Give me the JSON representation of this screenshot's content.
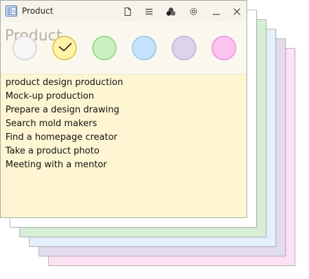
{
  "window": {
    "title": "Product",
    "ghost_title": "Product"
  },
  "toolbar": {
    "icons": [
      "app-note-icon",
      "new-note-icon",
      "list-icon",
      "color-icon",
      "settings-icon",
      "minimize-icon",
      "close-icon"
    ]
  },
  "colors": {
    "swatches": [
      {
        "name": "white",
        "fill": "#f6f6f6",
        "selected": false
      },
      {
        "name": "yellow",
        "fill": "#fff3a8",
        "selected": true
      },
      {
        "name": "green",
        "fill": "#c8f0c0",
        "selected": false
      },
      {
        "name": "blue",
        "fill": "#c4e4fb",
        "selected": false
      },
      {
        "name": "purple",
        "fill": "#ddd3ea",
        "selected": false
      },
      {
        "name": "pink",
        "fill": "#fcc4f0",
        "selected": false
      }
    ],
    "note_background": "#fef6d2",
    "stacked_sheets": [
      "#ffffff",
      "#d6efd6",
      "#e4f0fb",
      "#e3dcee",
      "#fde2f3"
    ]
  },
  "note": {
    "lines": [
      "product design production",
      "Mock-up production",
      "Prepare a design drawing",
      "Search mold makers",
      "Find a homepage creator",
      "Take a product photo",
      "Meeting with a mentor"
    ]
  }
}
